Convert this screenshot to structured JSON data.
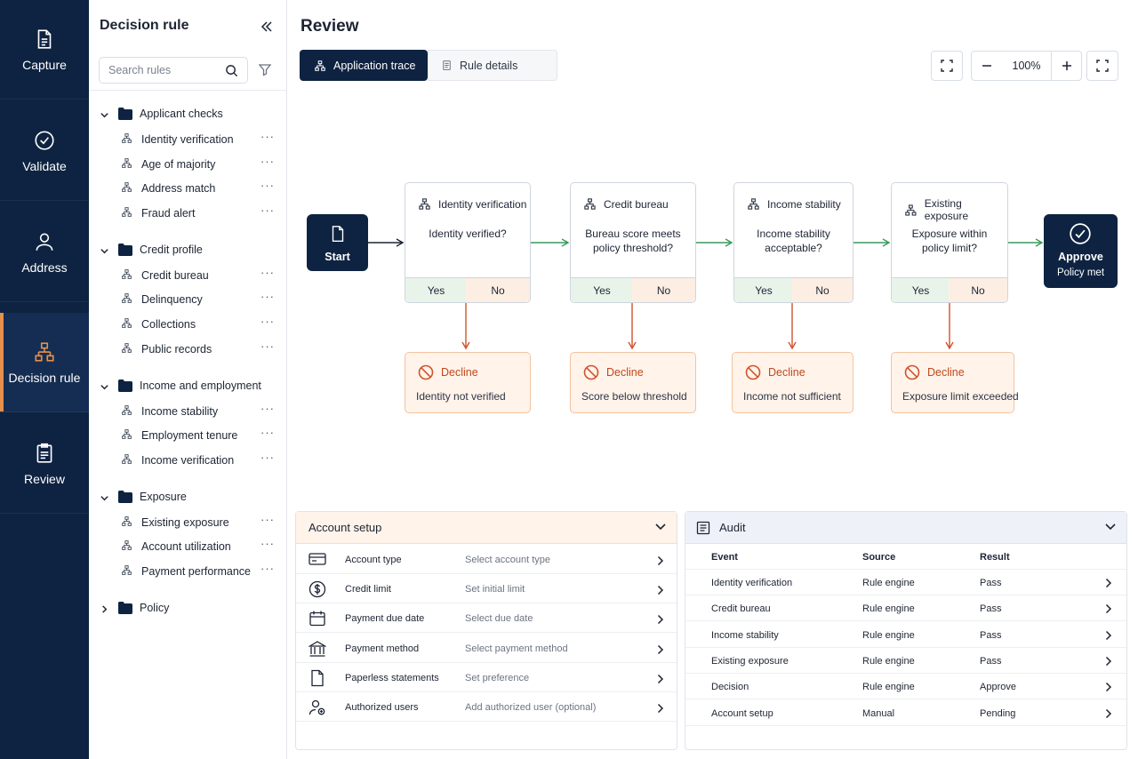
{
  "rail": {
    "items": [
      {
        "label": "Capture",
        "icon": "document-icon"
      },
      {
        "label": "Validate",
        "icon": "check-circle-icon"
      },
      {
        "label": "Address",
        "icon": "person-icon"
      },
      {
        "label": "Decision rule",
        "icon": "hierarchy-icon"
      },
      {
        "label": "Review",
        "icon": "clipboard-icon"
      }
    ],
    "active": "Decision rule"
  },
  "sidebar": {
    "title": "Decision rule",
    "search_placeholder": "Search rules",
    "groups": [
      {
        "label": "Applicant checks",
        "expanded": true,
        "children": [
          "Identity verification",
          "Age of majority",
          "Address match",
          "Fraud alert"
        ]
      },
      {
        "label": "Credit profile",
        "expanded": true,
        "children": [
          "Credit bureau",
          "Delinquency",
          "Collections",
          "Public records"
        ]
      },
      {
        "label": "Income and employment",
        "expanded": true,
        "children": [
          "Income stability",
          "Employment tenure",
          "Income verification"
        ]
      },
      {
        "label": "Exposure",
        "expanded": true,
        "children": [
          "Existing exposure",
          "Account utilization",
          "Payment performance"
        ]
      },
      {
        "label": "Policy",
        "expanded": false,
        "children": []
      }
    ],
    "more_glyph": "···"
  },
  "main": {
    "title": "Review",
    "tabs": [
      {
        "label": "Application trace",
        "active": true
      },
      {
        "label": "Rule details",
        "active": false
      }
    ],
    "zoom": "100%"
  },
  "flow": {
    "start": "Start",
    "end": {
      "title": "Approve",
      "subtitle": "Policy met"
    },
    "steps": [
      {
        "title": "Identity verification",
        "question": [
          "Identity verified?"
        ],
        "yes": "Yes",
        "no": "No",
        "decline_title": "Decline",
        "decline_reason": "Identity not verified"
      },
      {
        "title": "Credit bureau",
        "question": [
          "Bureau score meets",
          "policy threshold?"
        ],
        "yes": "Yes",
        "no": "No",
        "decline_title": "Decline",
        "decline_reason": "Score below threshold"
      },
      {
        "title": "Income stability",
        "question": [
          "Income stability",
          "acceptable?"
        ],
        "yes": "Yes",
        "no": "No",
        "decline_title": "Decline",
        "decline_reason": "Income not sufficient"
      },
      {
        "title": "Existing exposure",
        "question": [
          "Exposure within",
          "policy limit?"
        ],
        "yes": "Yes",
        "no": "No",
        "decline_title": "Decline",
        "decline_reason": "Exposure limit exceeded"
      }
    ],
    "colors": {
      "primary": "#0e2341",
      "accent": "#e7904c",
      "yes_arrow": "#3a9a5b",
      "no_arrow": "#d0532a"
    }
  },
  "account_setup": {
    "title": "Account setup",
    "rows": [
      {
        "label": "Account type",
        "value": "Select account type",
        "icon": "card-icon"
      },
      {
        "label": "Credit limit",
        "value": "Set initial limit",
        "icon": "dollar-icon"
      },
      {
        "label": "Payment due date",
        "value": "Select due date",
        "icon": "calendar-icon"
      },
      {
        "label": "Payment method",
        "value": "Select payment method",
        "icon": "bank-icon"
      },
      {
        "label": "Paperless statements",
        "value": "Set preference",
        "icon": "file-icon"
      },
      {
        "label": "Authorized users",
        "value": "Add authorized user (optional)",
        "icon": "users-icon"
      }
    ]
  },
  "audit": {
    "title": "Audit",
    "columns": [
      "Event",
      "Source",
      "Result"
    ],
    "rows": [
      [
        "Identity verification",
        "Rule engine",
        "Pass"
      ],
      [
        "Credit bureau",
        "Rule engine",
        "Pass"
      ],
      [
        "Income stability",
        "Rule engine",
        "Pass"
      ],
      [
        "Existing exposure",
        "Rule engine",
        "Pass"
      ],
      [
        "Decision",
        "Rule engine",
        "Approve"
      ],
      [
        "Account setup",
        "Manual",
        "Pending"
      ]
    ]
  }
}
